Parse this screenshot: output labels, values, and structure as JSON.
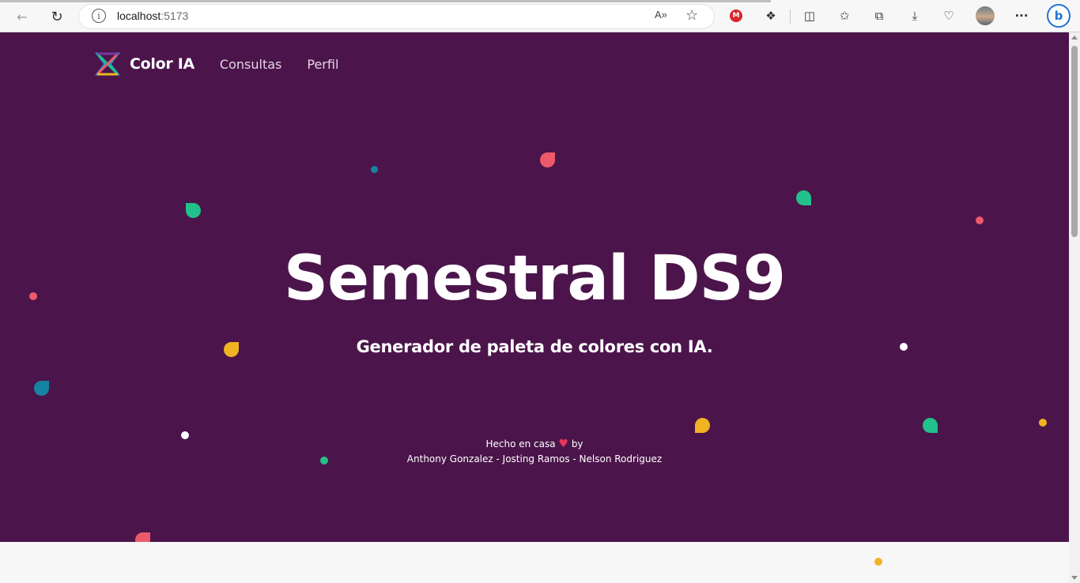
{
  "browser": {
    "url_host": "localhost",
    "url_port": ":5173",
    "read_aloud_label": "A»",
    "icons": [
      "back-icon",
      "refresh-icon",
      "info-icon",
      "read-aloud-icon",
      "favorite-star-icon",
      "mega-extension-icon",
      "extensions-icon",
      "split-screen-icon",
      "favorites-icon",
      "collections-icon",
      "downloads-icon",
      "performance-icon",
      "profile-avatar-icon",
      "more-icon",
      "bing-copilot-icon"
    ]
  },
  "nav": {
    "brand": "Color IA",
    "links": [
      "Consultas",
      "Perfil"
    ]
  },
  "hero": {
    "title": "Semestral DS9",
    "subtitle": "Generador de paleta de colores con IA.",
    "credit_line1_before": "Hecho en casa",
    "credit_heart": "♥",
    "credit_line1_after": "by",
    "credit_line2": "Anthony Gonzalez - Josting Ramos - Nelson Rodriguez"
  },
  "colors": {
    "background": "#4b154b",
    "red": "#ec5a6a",
    "green": "#22c08a",
    "yellow": "#f0b323",
    "blue": "#1783a3",
    "white": "#ffffff"
  }
}
